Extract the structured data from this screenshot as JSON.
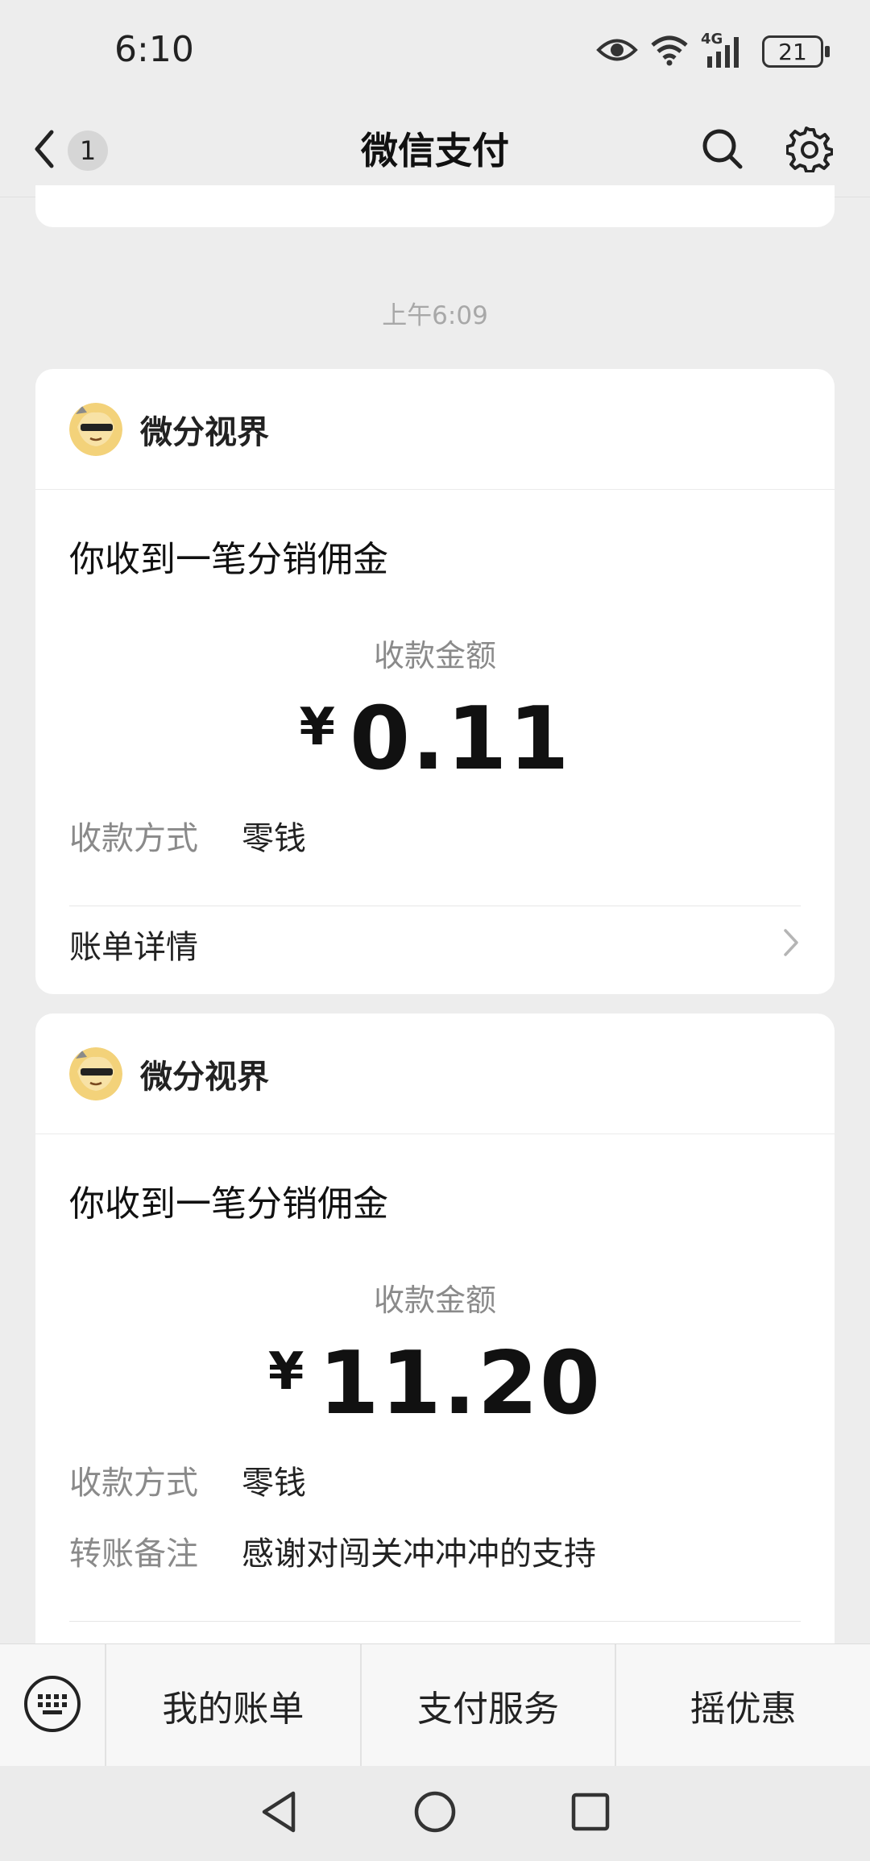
{
  "status_bar": {
    "time": "6:10",
    "battery": "21",
    "network": "4G",
    "icons": [
      "eye-icon",
      "wifi-icon",
      "signal-icon",
      "battery-icon"
    ]
  },
  "nav": {
    "badge_count": "1",
    "title": "微信支付",
    "icons": [
      "back-chevron-icon",
      "search-icon",
      "gear-icon"
    ]
  },
  "chat": {
    "timestamp": "上午6:09",
    "cards": [
      {
        "merchant": "微分视界",
        "title": "你收到一笔分销佣金",
        "amount_label": "收款金额",
        "currency": "¥",
        "amount": "0.11",
        "rows": [
          {
            "label": "收款方式",
            "value": "零钱"
          }
        ],
        "bill_label": "账单详情"
      },
      {
        "merchant": "微分视界",
        "title": "你收到一笔分销佣金",
        "amount_label": "收款金额",
        "currency": "¥",
        "amount": "11.20",
        "rows": [
          {
            "label": "收款方式",
            "value": "零钱"
          },
          {
            "label": "转账备注",
            "value": "感谢对闯关冲冲冲的支持"
          }
        ]
      }
    ]
  },
  "bottom_menu": {
    "items": [
      "我的账单",
      "支付服务",
      "摇优惠"
    ],
    "keyboard_icon": "keyboard-icon"
  },
  "system_nav": {
    "icons": [
      "back-triangle-icon",
      "home-circle-icon",
      "recents-square-icon"
    ]
  },
  "colors": {
    "background": "#ededed",
    "card": "#ffffff",
    "muted_text": "#8a8a8a",
    "primary_text": "#111111"
  }
}
